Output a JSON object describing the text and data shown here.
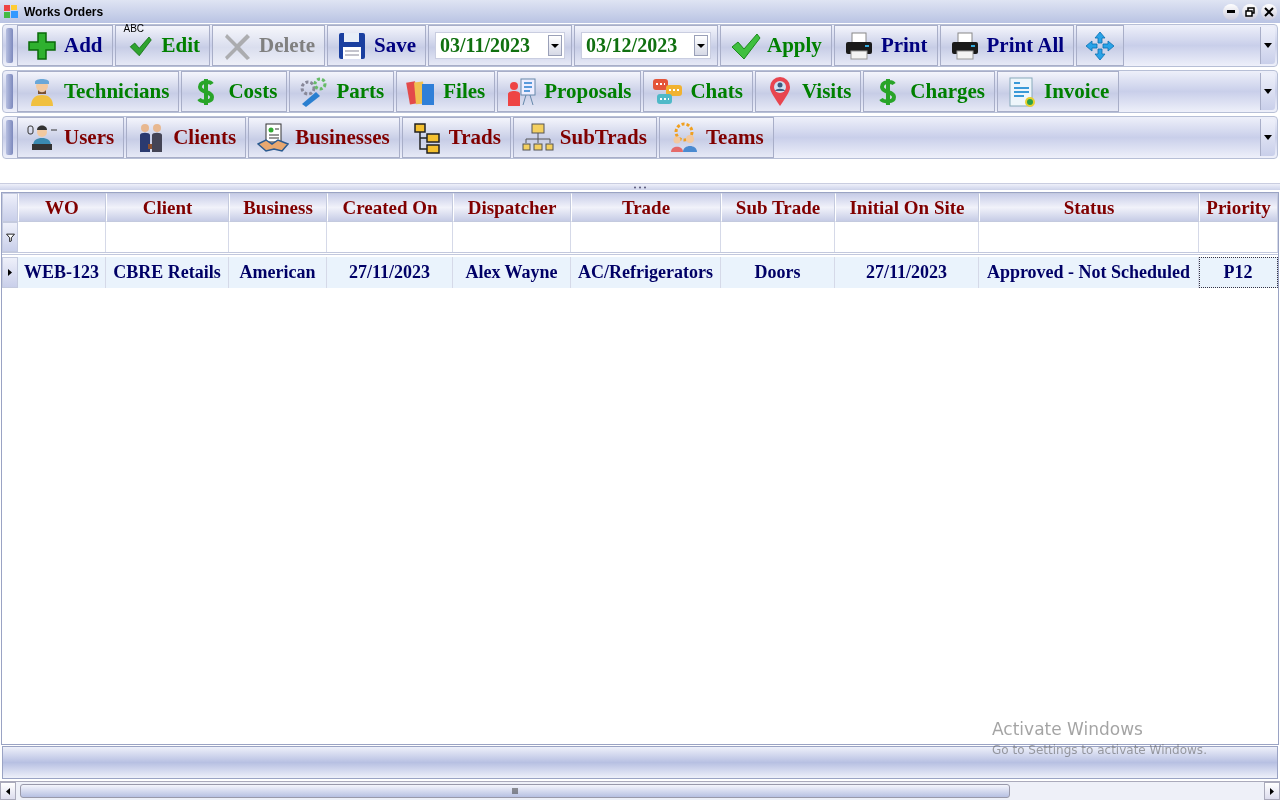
{
  "window": {
    "title": "Works Orders"
  },
  "toolbars": [
    {
      "items": [
        {
          "kind": "button",
          "label": "Add",
          "color": "#000080",
          "disabled": false
        },
        {
          "kind": "button",
          "label": "Edit",
          "icon_text": "ABC",
          "color": "#008000",
          "disabled": false
        },
        {
          "kind": "button",
          "label": "Delete",
          "color": "#808080",
          "disabled": true
        },
        {
          "kind": "button",
          "label": "Save",
          "color": "#000080",
          "disabled": false
        },
        {
          "kind": "date",
          "value": "03/11/2023"
        },
        {
          "kind": "date",
          "value": "03/12/2023"
        },
        {
          "kind": "button",
          "label": "Apply",
          "color": "#008000",
          "disabled": false
        },
        {
          "kind": "button",
          "label": "Print",
          "color": "#000080",
          "disabled": false
        },
        {
          "kind": "button",
          "label": "Print All",
          "color": "#000080",
          "disabled": false
        },
        {
          "kind": "icon_button",
          "disabled": false
        }
      ]
    },
    {
      "items": [
        {
          "kind": "button",
          "label": "Technicians",
          "color": "#008000",
          "disabled": false
        },
        {
          "kind": "button",
          "label": "Costs",
          "color": "#008000",
          "disabled": false
        },
        {
          "kind": "button",
          "label": "Parts",
          "color": "#008000",
          "disabled": false
        },
        {
          "kind": "button",
          "label": "Files",
          "color": "#008000",
          "disabled": false
        },
        {
          "kind": "button",
          "label": "Proposals",
          "color": "#008000",
          "disabled": false
        },
        {
          "kind": "button",
          "label": "Chats",
          "color": "#008000",
          "disabled": false
        },
        {
          "kind": "button",
          "label": "Visits",
          "color": "#008000",
          "disabled": false
        },
        {
          "kind": "button",
          "label": "Charges",
          "color": "#008000",
          "disabled": false
        },
        {
          "kind": "button",
          "label": "Invoice",
          "color": "#008000",
          "disabled": false
        }
      ]
    },
    {
      "items": [
        {
          "kind": "button",
          "label": "Users",
          "color": "#800000",
          "disabled": false
        },
        {
          "kind": "button",
          "label": "Clients",
          "color": "#800000",
          "disabled": false
        },
        {
          "kind": "button",
          "label": "Businesses",
          "color": "#800000",
          "disabled": false
        },
        {
          "kind": "button",
          "label": "Trads",
          "color": "#800000",
          "disabled": false
        },
        {
          "kind": "button",
          "label": "SubTrads",
          "color": "#800000",
          "disabled": false
        },
        {
          "kind": "button",
          "label": "Teams",
          "color": "#800000",
          "disabled": false
        }
      ]
    }
  ],
  "grid": {
    "columns": [
      "WO",
      "Client",
      "Business",
      "Created On",
      "Dispatcher",
      "Trade",
      "Sub Trade",
      "Initial On Site",
      "Status",
      "Priority"
    ],
    "rows": [
      {
        "selected": true,
        "cells": [
          {
            "text": "WEB-123",
            "focused": false
          },
          {
            "text": "CBRE Retails",
            "focused": false
          },
          {
            "text": "American",
            "focused": false
          },
          {
            "text": "27/11/2023",
            "focused": false
          },
          {
            "text": "Alex Wayne",
            "focused": false
          },
          {
            "text": "AC/Refrigerators",
            "focused": false
          },
          {
            "text": "Doors",
            "focused": false
          },
          {
            "text": "27/11/2023",
            "focused": false
          },
          {
            "text": "Approved - Not Scheduled",
            "focused": false
          },
          {
            "text": "P12",
            "focused": true
          }
        ]
      }
    ]
  },
  "os_notice": {
    "title": "Activate Windows",
    "subtitle": "Go to Settings to activate Windows."
  }
}
